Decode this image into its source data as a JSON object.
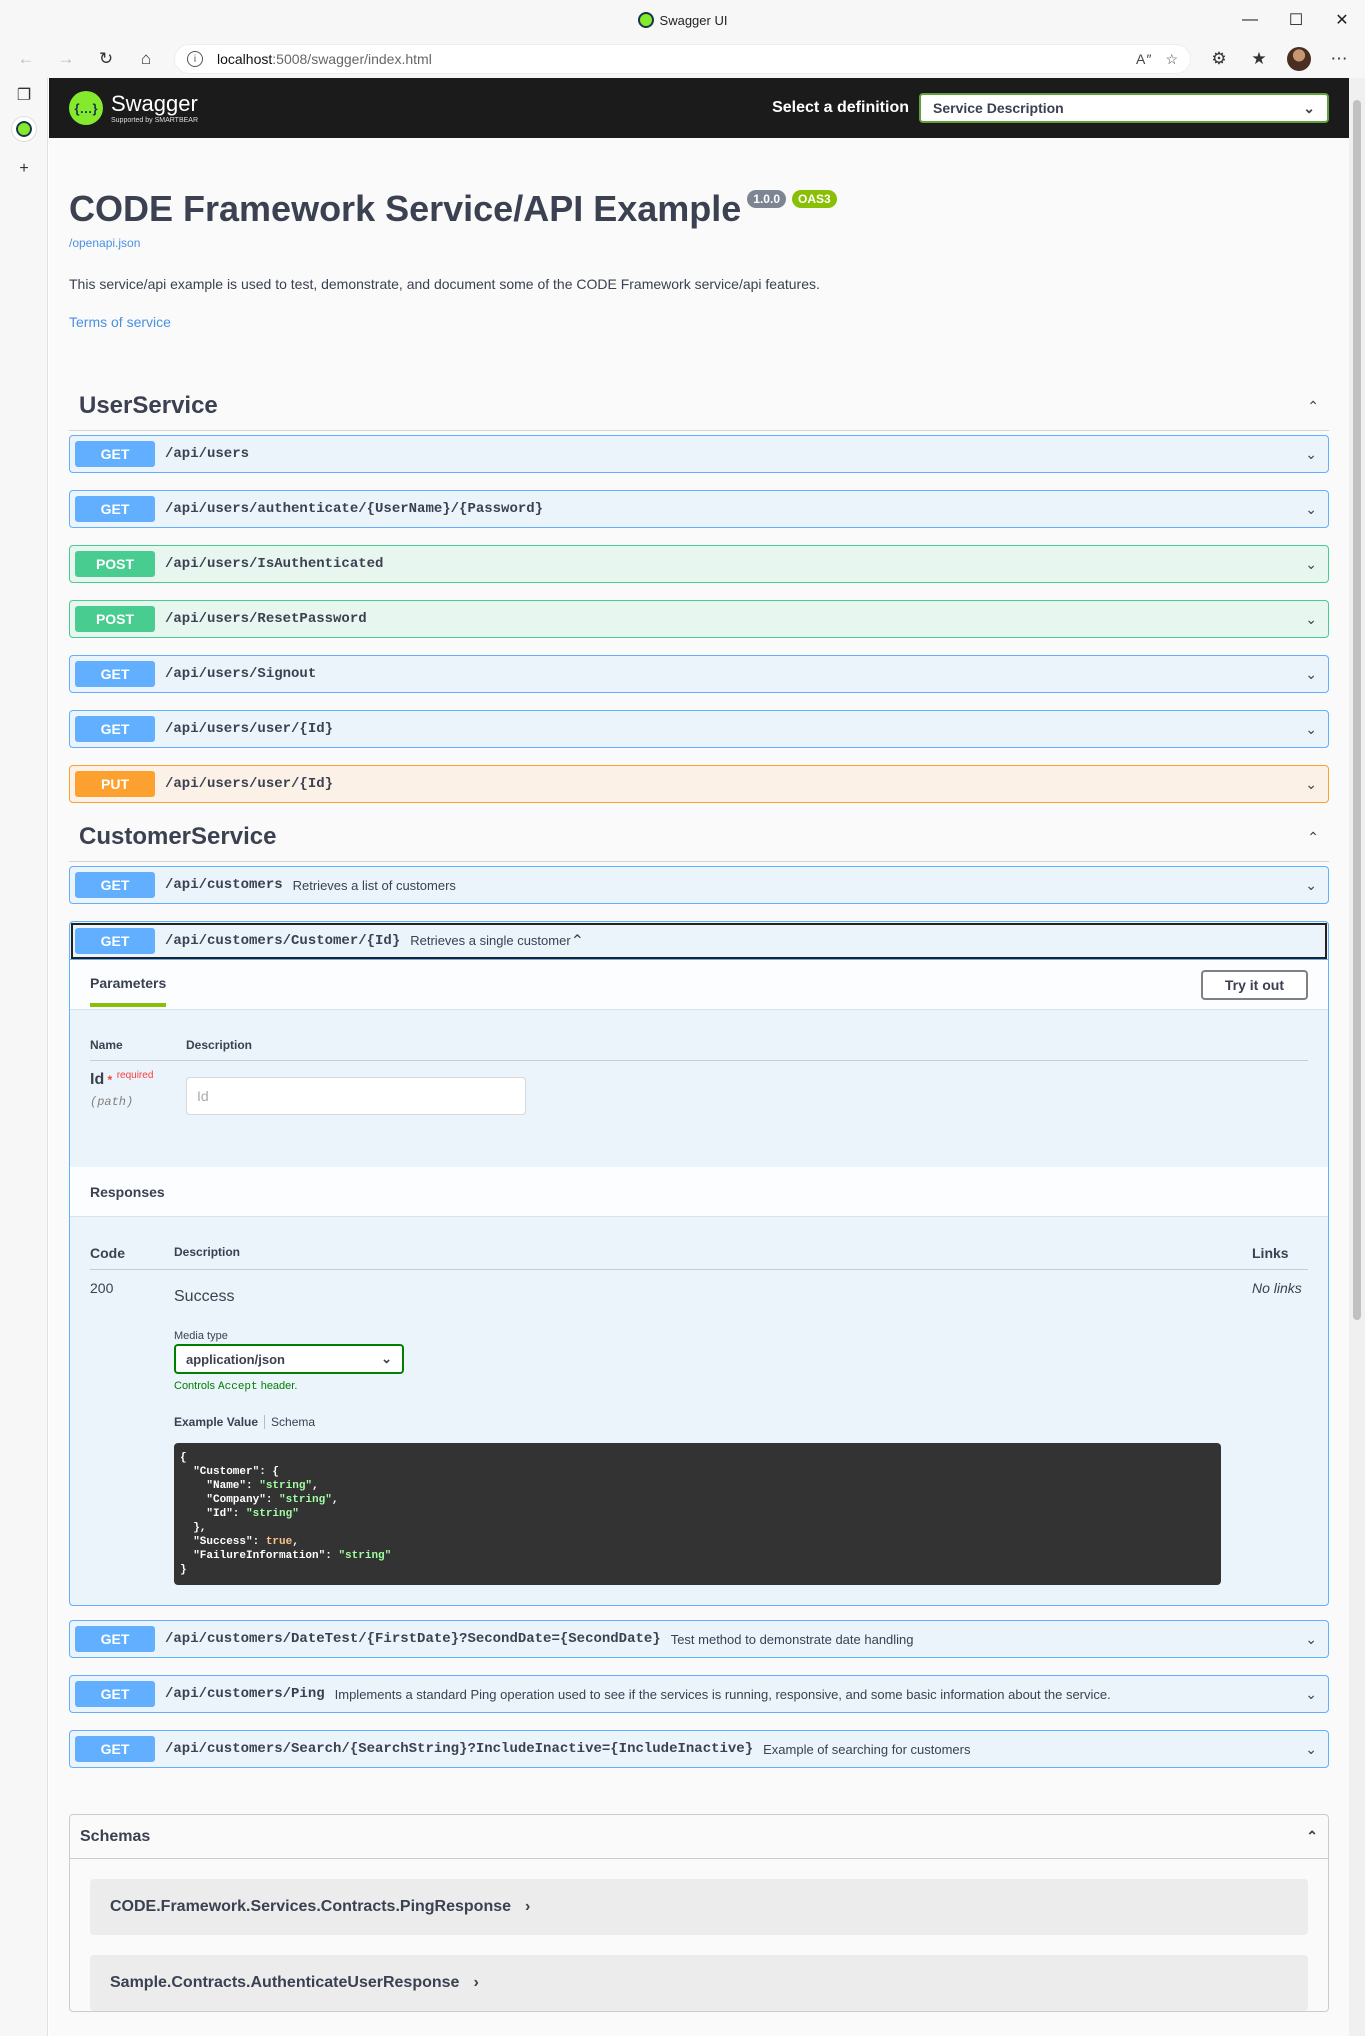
{
  "browser": {
    "tab_title": "Swagger UI",
    "url": "localhost:5008/swagger/index.html",
    "url_host": "localhost",
    "url_rest": ":5008/swagger/index.html"
  },
  "swagger": {
    "logo_text": "Swagger",
    "logo_sub": "Supported by SMARTBEAR",
    "definition_label": "Select a definition",
    "definition_value": "Service Description"
  },
  "info": {
    "title": "CODE Framework Service/API Example",
    "version": "1.0.0",
    "oas": "OAS3",
    "spec_link": "/openapi.json",
    "description": "This service/api example is used to test, demonstrate, and document some of the CODE Framework service/api features.",
    "terms": "Terms of service"
  },
  "tags": [
    {
      "name": "UserService",
      "ops": [
        {
          "method": "GET",
          "path": "/api/users",
          "summary": ""
        },
        {
          "method": "GET",
          "path": "/api/users/authenticate/{UserName}/{Password}",
          "summary": ""
        },
        {
          "method": "POST",
          "path": "/api/users/IsAuthenticated",
          "summary": ""
        },
        {
          "method": "POST",
          "path": "/api/users/ResetPassword",
          "summary": ""
        },
        {
          "method": "GET",
          "path": "/api/users/Signout",
          "summary": ""
        },
        {
          "method": "GET",
          "path": "/api/users/user/{Id}",
          "summary": ""
        },
        {
          "method": "PUT",
          "path": "/api/users/user/{Id}",
          "summary": ""
        }
      ]
    },
    {
      "name": "CustomerService",
      "ops": [
        {
          "method": "GET",
          "path": "/api/customers",
          "summary": "Retrieves a list of customers"
        },
        {
          "method": "GET",
          "path": "/api/customers/Customer/{Id}",
          "summary": "Retrieves a single customer"
        },
        {
          "method": "GET",
          "path": "/api/customers/DateTest/{FirstDate}?SecondDate={SecondDate}",
          "summary": "Test method to demonstrate date handling"
        },
        {
          "method": "GET",
          "path": "/api/customers/Ping",
          "summary": "Implements a standard Ping operation used to see if the services is running, responsive, and some basic information about the service."
        },
        {
          "method": "GET",
          "path": "/api/customers/Search/{SearchString}?IncludeInactive={IncludeInactive}",
          "summary": "Example of searching for customers"
        }
      ]
    }
  ],
  "expanded": {
    "tab_parameters": "Parameters",
    "try_it_out": "Try it out",
    "col_name": "Name",
    "col_description": "Description",
    "param_name": "Id",
    "param_required": "required",
    "param_location": "(path)",
    "param_placeholder": "Id",
    "responses_title": "Responses",
    "col_code": "Code",
    "col_links": "Links",
    "resp_code": "200",
    "resp_desc": "Success",
    "resp_links": "No links",
    "media_type_label": "Media type",
    "media_type_value": "application/json",
    "controls_prefix": "Controls ",
    "controls_code": "Accept",
    "controls_suffix": " header.",
    "example_tab": "Example Value",
    "schema_tab": "Schema"
  },
  "schemas": {
    "title": "Schemas",
    "models": [
      "CODE.Framework.Services.Contracts.PingResponse",
      "Sample.Contracts.AuthenticateUserResponse"
    ]
  }
}
